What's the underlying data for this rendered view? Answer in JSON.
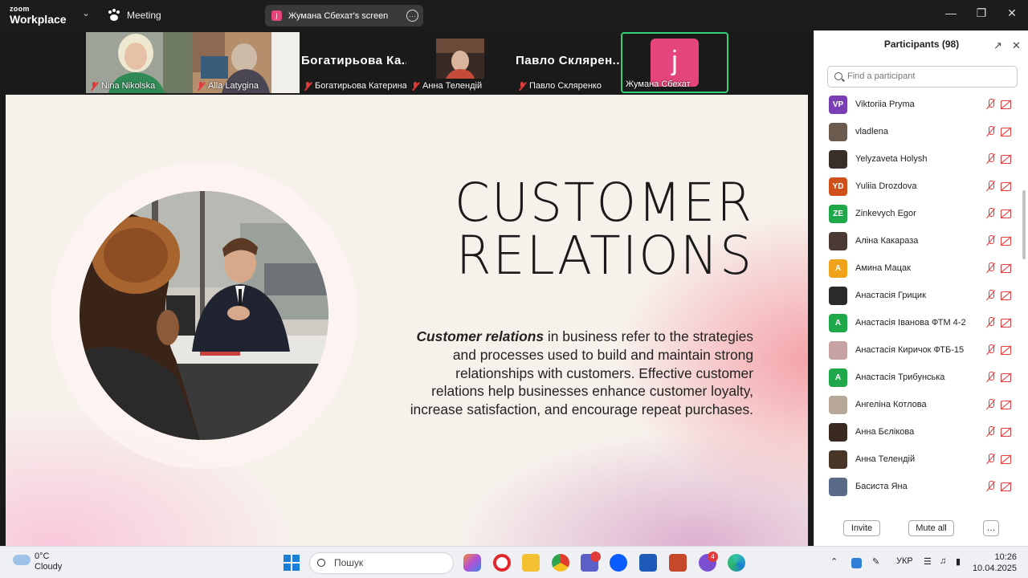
{
  "app": {
    "brand_top": "zoom",
    "brand_bottom": "Workplace",
    "meeting_label": "Meeting",
    "share_avatar": "j",
    "share_title": "Жумана Сбехат's screen"
  },
  "video_strip": [
    {
      "name": "Nina Nikolska",
      "muted": true
    },
    {
      "name": "Alla Latygina",
      "muted": true
    },
    {
      "name": "Богатирьова Катерина",
      "display": "Богатирьова Ка...",
      "muted": true
    },
    {
      "name": "Анна Телендій",
      "muted": true
    },
    {
      "name": "Павло Скляренко",
      "display": "Павло Скляpен...",
      "muted": true
    },
    {
      "name": "Жумана Сбехат",
      "avatar": "j",
      "active": true
    }
  ],
  "slide": {
    "title_line1": "CUSTOMER",
    "title_line2": "RELATIONS",
    "body_bold": "Customer relations",
    "body_rest": " in business refer to the strategies and processes used to build and maintain strong relationships with customers. Effective customer relations help businesses enhance customer loyalty, increase satisfaction, and encourage repeat purchases."
  },
  "participants": {
    "title": "Participants (98)",
    "search_placeholder": "Find a participant",
    "items": [
      {
        "name": "Viktoriia Pryma",
        "initials": "VP",
        "color": "#7a3fb5"
      },
      {
        "name": "vladlena",
        "initials": "",
        "color": "#6b5a4e"
      },
      {
        "name": "Yelyzaveta Holysh",
        "initials": "",
        "color": "#3a2e2a"
      },
      {
        "name": "Yuliia Drozdova",
        "initials": "YD",
        "color": "#d0501c"
      },
      {
        "name": "Zinkevych Egor",
        "initials": "ZE",
        "color": "#1fa84a"
      },
      {
        "name": "Аліна Какараза",
        "initials": "",
        "color": "#4a3a33"
      },
      {
        "name": "Амина Мацак",
        "initials": "A",
        "color": "#f0a21a"
      },
      {
        "name": "Анастасія Грицик",
        "initials": "",
        "color": "#2a2a2a"
      },
      {
        "name": "Анастасія Іванова ФТМ 4-2",
        "initials": "A",
        "color": "#1fa84a"
      },
      {
        "name": "Анастасія Киричок ФТБ-15",
        "initials": "",
        "color": "#c7a3a3"
      },
      {
        "name": "Анастасія Трибунська",
        "initials": "A",
        "color": "#1fa84a"
      },
      {
        "name": "Ангеліна Котлова",
        "initials": "",
        "color": "#b8a89a"
      },
      {
        "name": "Анна Бєлікова",
        "initials": "",
        "color": "#3a2a22"
      },
      {
        "name": "Анна Телендій",
        "initials": "",
        "color": "#4a3628"
      },
      {
        "name": "Басиста Яна",
        "initials": "",
        "color": "#5b6a86"
      }
    ],
    "invite_label": "Invite",
    "mute_all_label": "Mute all",
    "more_label": "…"
  },
  "taskbar": {
    "temp": "0°C",
    "weather": "Cloudy",
    "search_placeholder": "Пошук",
    "language": "УКР",
    "time": "10:26",
    "date": "10.04.2025",
    "viber_badge": "4"
  }
}
